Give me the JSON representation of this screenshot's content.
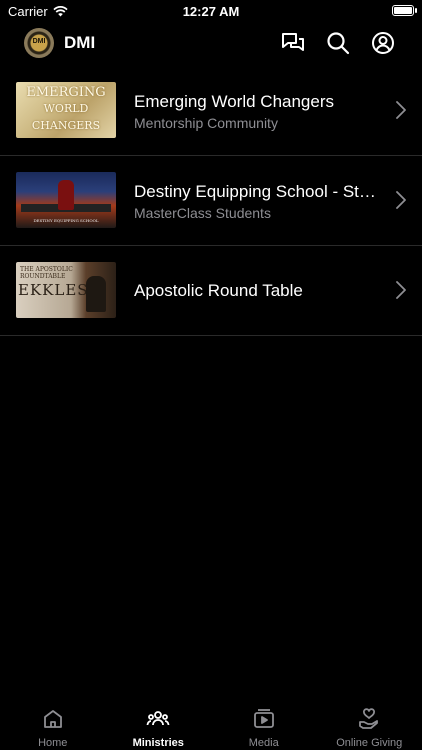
{
  "status": {
    "carrier": "Carrier",
    "time": "12:27 AM"
  },
  "header": {
    "title": "DMI",
    "icons": [
      "chat-bubbles-icon",
      "search-icon",
      "account-icon"
    ]
  },
  "list": [
    {
      "title": "Emerging World Changers",
      "subtitle": "Mentorship Community",
      "thumb_text": [
        "EMERGING",
        "WORLD",
        "CHANGERS"
      ]
    },
    {
      "title": "Destiny Equipping School - Students",
      "subtitle": "MasterClass Students",
      "thumb_text": [
        "DESTINY EQUIPPING SCHOOL"
      ]
    },
    {
      "title": "Apostolic Round Table",
      "subtitle": "",
      "thumb_text": [
        "THE APOSTOLIC ROUNDTABLE",
        "EKKLES"
      ]
    }
  ],
  "tabs": [
    {
      "label": "Home",
      "icon": "home-icon",
      "active": false
    },
    {
      "label": "Ministries",
      "icon": "people-icon",
      "active": true
    },
    {
      "label": "Media",
      "icon": "media-play-icon",
      "active": false
    },
    {
      "label": "Online Giving",
      "icon": "giving-hand-icon",
      "active": false
    }
  ],
  "colors": {
    "background": "#000000",
    "text": "#ffffff",
    "secondary": "#8e8e93",
    "divider": "#2a2a2a"
  }
}
